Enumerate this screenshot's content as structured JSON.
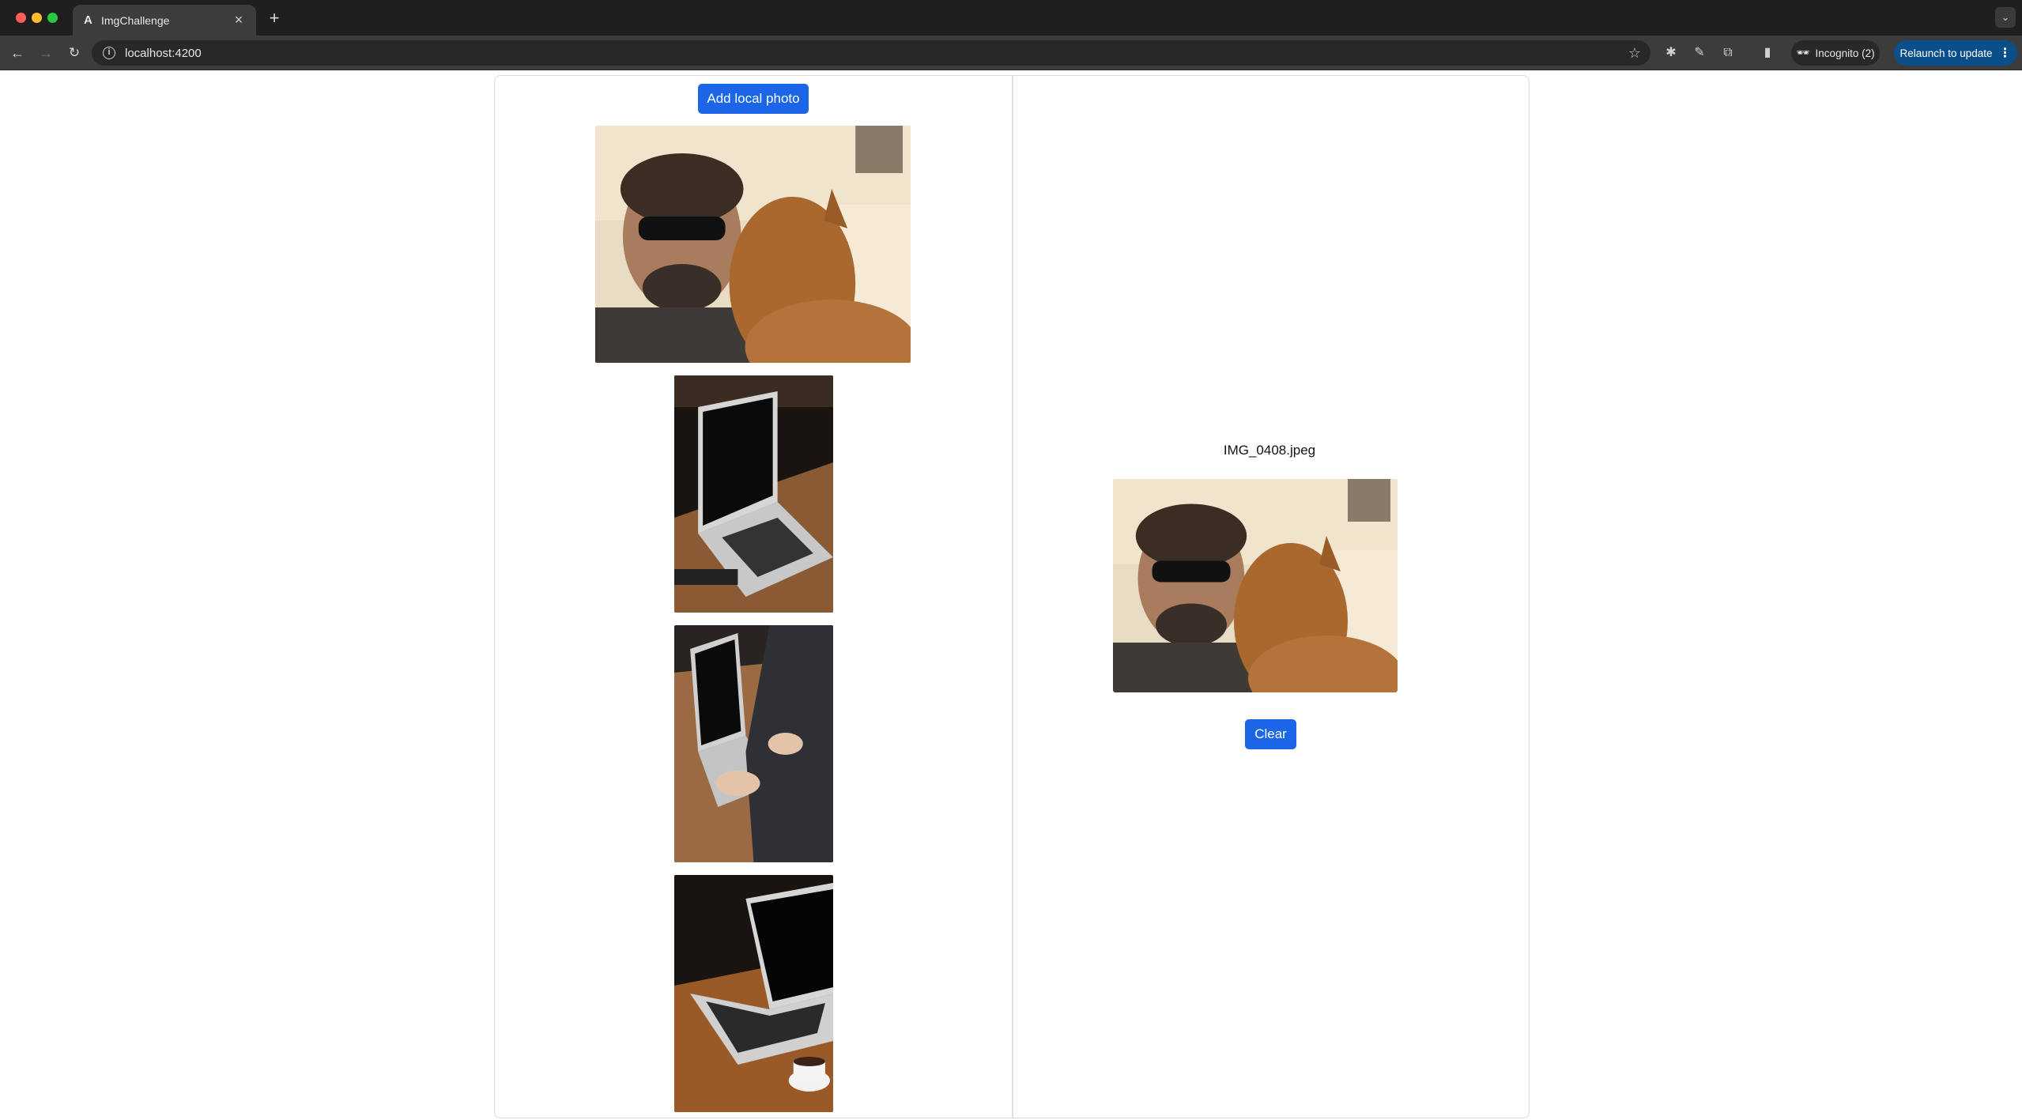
{
  "browser": {
    "tab_title": "ImgChallenge",
    "tab_favicon": "A",
    "url": "localhost:4200",
    "incognito_label": "Incognito (2)",
    "relaunch_label": "Relaunch to update",
    "icons": [
      "back-icon",
      "forward-icon",
      "reload-icon",
      "info-icon",
      "star-icon",
      "extensions-icon",
      "side-panel-icon",
      "incognito-icon",
      "more-icon"
    ]
  },
  "page": {
    "add_button_label": "Add local photo",
    "gallery": [
      {
        "alt": "man with sunglasses and alpaca"
      },
      {
        "alt": "laptop on wooden desk"
      },
      {
        "alt": "person typing on laptop"
      },
      {
        "alt": "laptop with coffee cup"
      }
    ],
    "selected": {
      "file_name": "IMG_0408.jpeg",
      "clear_button_label": "Clear"
    }
  },
  "colors": {
    "button": "#1a66e6",
    "relaunch": "#0b4f8a",
    "border": "#d9d9d9"
  }
}
